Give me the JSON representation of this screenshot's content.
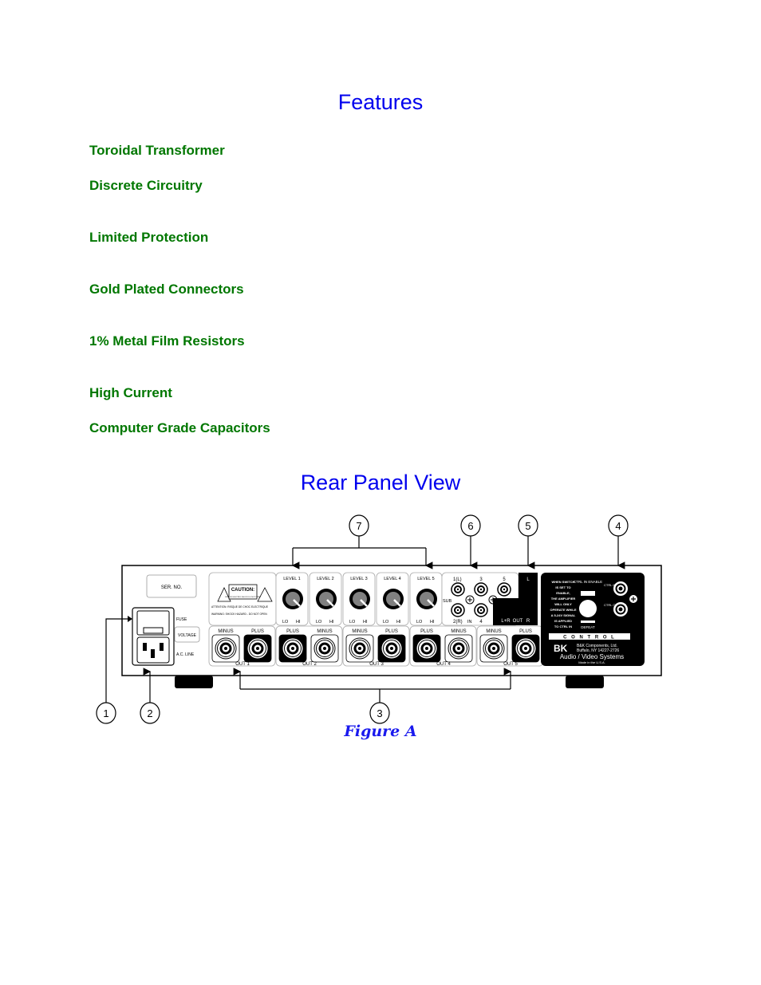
{
  "features_section": {
    "title": "Features",
    "items": [
      "Toroidal Transformer",
      "Discrete Circuitry",
      "Limited Protection",
      "Gold Plated Connectors",
      "1% Metal Film Resistors",
      "High Current",
      "Computer Grade Capacitors"
    ]
  },
  "rear_panel_section": {
    "title": "Rear Panel View",
    "figure_caption": "Figure A",
    "callouts": [
      "1",
      "2",
      "3",
      "4",
      "5",
      "6",
      "7"
    ],
    "panel": {
      "serial_label": "SER. NO.",
      "fuse_label": "FUSE",
      "voltage_label": "VOLTAGE",
      "ac_line_label": "A.C. LINE",
      "caution_title": "CAUTION:",
      "caution_sub": "RISK OF ELECTRIC SHOCK DO NOT OPEN",
      "attention_text": "ATTENTION: RISQUE DE CHOC ELECTRIQUE",
      "warning_text": "WARNING: SHOCK HAZARD - DO NOT OPEN",
      "levels": [
        "LEVEL 1",
        "LEVEL 2",
        "LEVEL 3",
        "LEVEL 4",
        "LEVEL 5"
      ],
      "lo_label": "LO",
      "hi_label": "HI",
      "outputs": [
        {
          "label": "OUT 1",
          "left": "MINUS",
          "right": "PLUS"
        },
        {
          "label": "OUT 2",
          "left": "PLUS",
          "right": "MINUS"
        },
        {
          "label": "OUT 3",
          "left": "MINUS",
          "right": "PLUS"
        },
        {
          "label": "OUT 4",
          "left": "PLUS",
          "right": "MINUS"
        },
        {
          "label": "OUT 5",
          "left": "MINUS",
          "right": "PLUS"
        }
      ],
      "inputs": {
        "in1": "1(L)",
        "in2": "2(R)",
        "in3": "3",
        "in4": "4",
        "in5": "5",
        "sub_label": "SUB",
        "in_label": "IN"
      },
      "sub_out": {
        "l": "L",
        "lr": "L+R",
        "out": "OUT",
        "r": "R"
      },
      "control": {
        "note": [
          "WHEN SWITCH",
          "IS SET TO",
          "ENABLE,",
          "THE AMPLIFIER",
          "WILL ONLY",
          "OPERATE WHILE",
          "A 5-24V SIGNAL",
          "IS APPLIED",
          "TO CTRL IN"
        ],
        "enable_label": "CTRL IN ENABLE",
        "defeat_label": "DEFEAT",
        "ctrl_in": "CTRL IN 5-24V",
        "ctrl_out": "CTRL OUT 12V",
        "control_word": "C O N T R O L",
        "brand_logo": "BK",
        "company": "B&K Components, Ltd.",
        "address": "Buffalo, NY 14227-2726",
        "tagline": "Audio / Video Systems",
        "made_in": "Made in the U.S.A."
      }
    }
  },
  "colors": {
    "heading": "#0000ee",
    "feature": "#007700",
    "caption": "#1a1aee",
    "panel_dark": "#000000",
    "knob": "#808080"
  }
}
